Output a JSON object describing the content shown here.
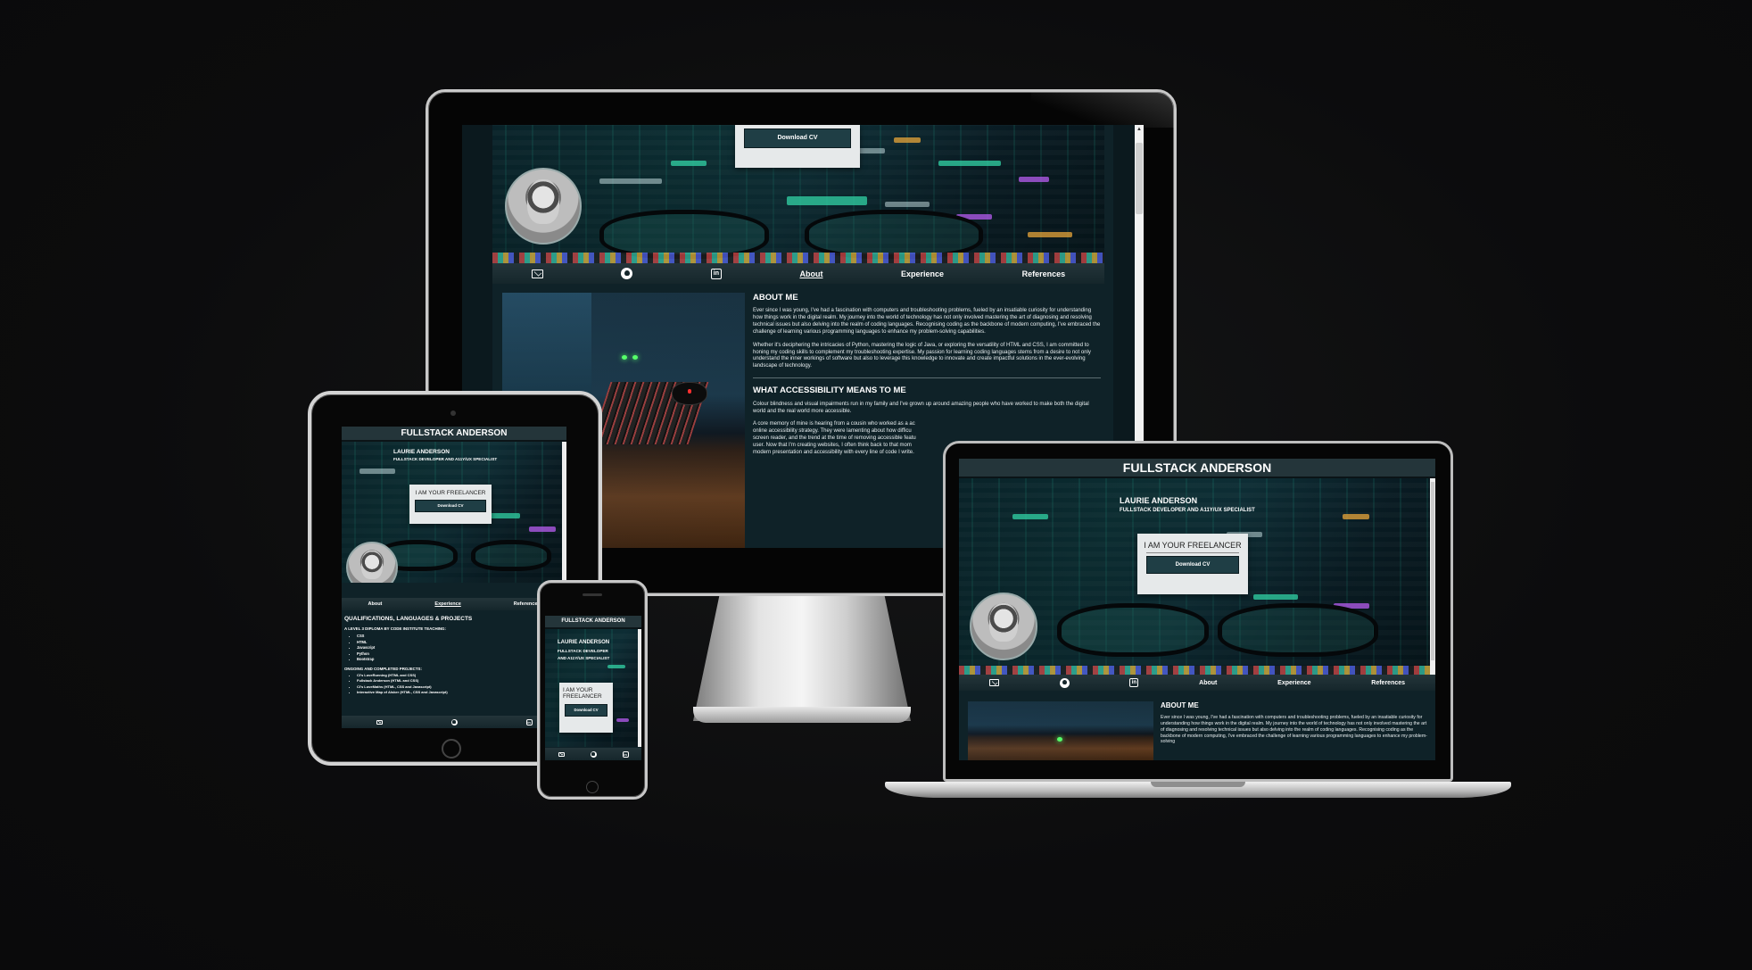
{
  "site": {
    "brand": "FULLSTACK ANDERSON",
    "name": "LAURIE ANDERSON",
    "role": "FULLSTACK DEVELOPER AND A11Y/UX SPECIALIST",
    "role_mobile_1": "FULLSTACK DEVELOPER",
    "role_mobile_2": "AND A11Y/UX SPECIALIST",
    "tagline": "I AM YOUR FREELANCER",
    "tagline_mobile_1": "I AM YOUR",
    "tagline_mobile_2": "FREELANCER",
    "cv_button": "Download CV"
  },
  "nav": {
    "about": "About",
    "experience": "Experience",
    "references": "References",
    "icons": [
      "envelope-icon",
      "github-icon",
      "linkedin-icon"
    ]
  },
  "about": {
    "title": "ABOUT ME",
    "p1": "Ever since I was young, I've had a fascination with computers and troubleshooting problems, fueled by an insatiable curiosity for understanding how things work in the digital realm. My journey into the world of technology has not only involved mastering the art of diagnosing and resolving technical issues but also delving into the realm of coding languages. Recognising coding as the backbone of modern computing, I've embraced the challenge of learning various programming languages to enhance my problem-solving capabilities.",
    "p2": "Whether it's deciphering the intricacies of Python, mastering the logic of Java, or exploring the versatility of HTML and CSS, I am committed to honing my coding skills to complement my troubleshooting expertise. My passion for learning coding languages stems from a desire to not only understand the inner workings of software but also to leverage this knowledge to innovate and create impactful solutions in the ever-evolving landscape of technology.",
    "a11y_title": "WHAT ACCESSIBILITY MEANS TO ME",
    "a11y_p1": "Colour blindness and visual impairments run in my family and I've grown up around amazing people who have worked to make both the digital world and the real world more accessible.",
    "a11y_p2_lines": [
      "A core memory of mine is hearing from a cousin who worked as a ac",
      "online accessibility strategy. They were lamenting about how difficu",
      "screen reader, and the trend at the time of removing accessible featu",
      "user. Now that I'm creating websites, I often think back to that mom",
      "modern presentation and accessibility with every line of code I write."
    ],
    "laptop_p1": "Ever since I was young, I've had a fascination with computers and troubleshooting problems, fueled by an insatiable curiosity for understanding how things work in the digital realm. My journey into the world of technology has not only involved mastering the art of diagnosing and resolving technical issues but also delving into the realm of coding languages. Recognising coding as the backbone of modern computing, I've embraced the challenge of learning various programming languages to enhance my problem-solving"
  },
  "qualifications": {
    "title": "QUALIFICATIONS, LANGUAGES & PROJECTS",
    "diploma": "A LEVEL 3 DIPLOMA BY CODE INSTITUTE TEACHING:",
    "languages": [
      "CSS",
      "HTML",
      "Javascript",
      "Python",
      "Bootstrap"
    ],
    "projects_title": "ONGOING AND COMPLETED PROJECTS:",
    "projects": [
      "CI's LoveRunning (HTML and CSS)",
      "Fullstack Anderson (HTML and CSS)",
      "CI's LoveMaths (HTML, CSS and Javascript)",
      "Interactive Map of Alsker (HTML, CSS and Javascript)"
    ]
  },
  "colors": {
    "page_bg": "#0f2228",
    "nav_bg": "#24353a",
    "cv_button": "#1f3e45",
    "cv_box": "#e6e9ea",
    "accent_code": "#31d3a6"
  }
}
